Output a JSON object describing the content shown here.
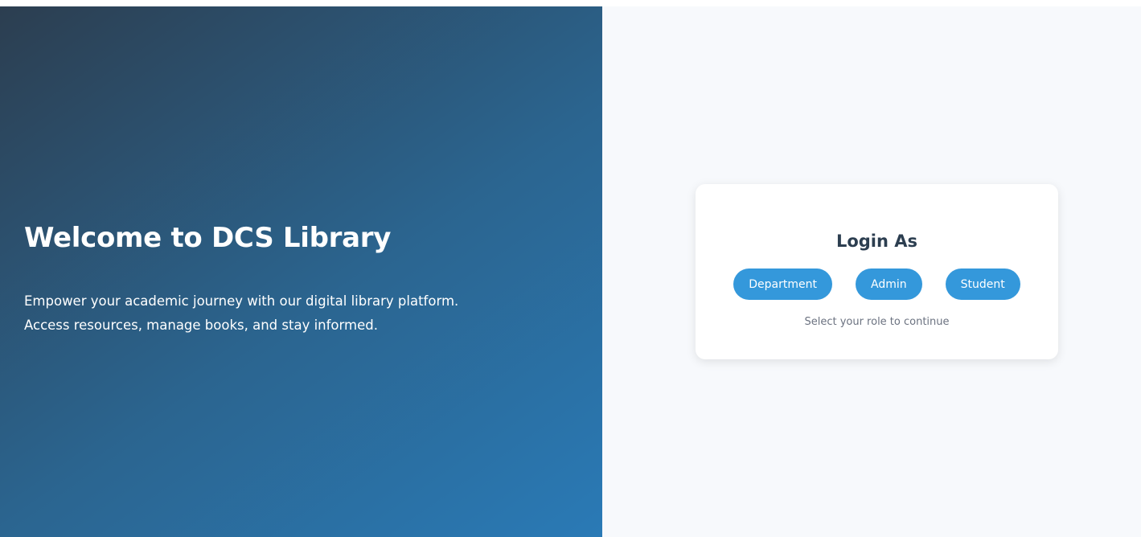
{
  "hero": {
    "title": "Welcome to DCS Library",
    "tagline_line1": "Empower your academic journey with our digital library platform.",
    "tagline_line2": "Access resources, manage books, and stay informed."
  },
  "login": {
    "title": "Login As",
    "roles": [
      "Department",
      "Admin",
      "Student"
    ],
    "hint": "Select your role to continue"
  },
  "colors": {
    "hero_gradient_start": "#2c3e50",
    "hero_gradient_end": "#2a7ab6",
    "button": "#3498db",
    "title_text": "#2c3e50",
    "panel_background": "#f7f9fc"
  }
}
